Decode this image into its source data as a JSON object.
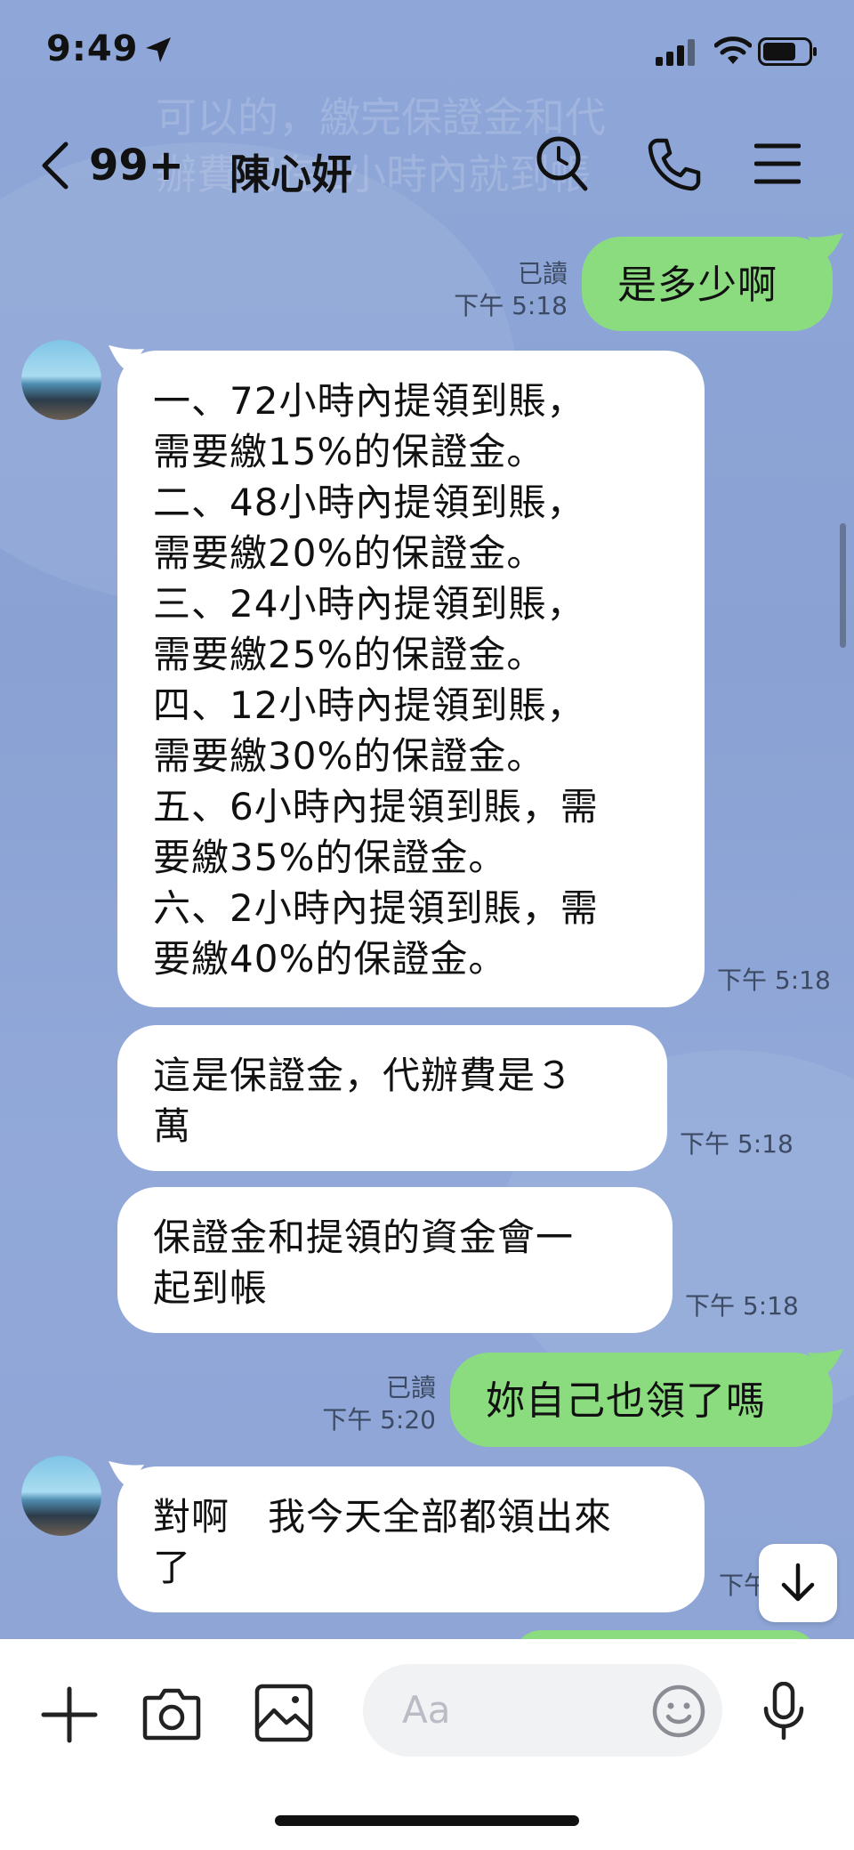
{
  "status_bar": {
    "time": "9:49"
  },
  "header": {
    "unread_count": "99+",
    "contact_name": "陳心妍"
  },
  "background_ghost_text": "可以的，繳完保證金和代\n辦費用在1小時內就到帳",
  "messages": [
    {
      "side": "me",
      "text": "是多少啊",
      "read": "已讀",
      "time": "下午 5:18"
    },
    {
      "side": "them",
      "text": "一、72小時內提領到賬，\n需要繳15%的保證金。\n二、48小時內提領到賬，\n需要繳20%的保證金。\n三、24小時內提領到賬，\n需要繳25%的保證金。\n四、12小時內提領到賬，\n需要繳30%的保證金。\n五、6小時內提領到賬，需\n要繳35%的保證金。\n六、2小時內提領到賬，需\n要繳40%的保證金。",
      "time": "下午 5:18"
    },
    {
      "side": "them",
      "text": "這是保證金，代辦費是３\n萬",
      "time": "下午 5:18"
    },
    {
      "side": "them",
      "text": "保證金和提領的資金會一\n起到帳",
      "time": "下午 5:18"
    },
    {
      "side": "me",
      "text": "妳自己也領了嗎",
      "read": "已讀",
      "time": "下午 5:20"
    },
    {
      "side": "them",
      "text": "對啊　我今天全部都領出來\n了",
      "time": "下午"
    }
  ],
  "input": {
    "placeholder": "Aa"
  },
  "colors": {
    "chat_bg": "#8ea6d6",
    "my_bubble": "#8bdc7f",
    "their_bubble": "#ffffff"
  },
  "icons": [
    "location-arrow-icon",
    "signal-icon",
    "wifi-icon",
    "battery-icon",
    "back-chevron-icon",
    "search-icon",
    "phone-icon",
    "menu-icon",
    "plus-icon",
    "camera-icon",
    "image-icon",
    "emoji-icon",
    "microphone-icon",
    "arrow-down-icon"
  ]
}
